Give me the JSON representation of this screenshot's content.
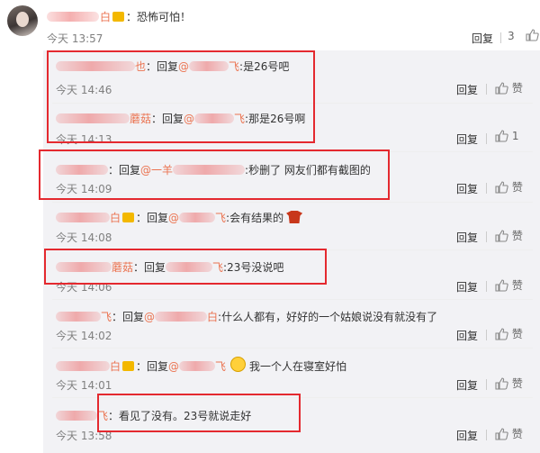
{
  "top_comment": {
    "text": "：恐怖可怕！",
    "time": "今天 13:57",
    "reply_label": "回复",
    "like_count": "3"
  },
  "replies": [
    {
      "name_tail": "也",
      "reply_prefix": "：回复",
      "mention_tail": "飞",
      "text": ":是26号吧",
      "time": "今天 14:46",
      "reply_label": "回复",
      "like_label": "赞"
    },
    {
      "name_tail": "蘑菇",
      "reply_prefix": "：回复",
      "mention_tail": "飞",
      "text": ":那是26号啊",
      "time": "今天 14:13",
      "reply_label": "回复",
      "like_count": "1"
    },
    {
      "reply_prefix": "：回复",
      "mention_head": "@一羊",
      "text": ":秒删了 网友们都有截图的",
      "time": "今天 14:09",
      "reply_label": "回复",
      "like_label": "赞"
    },
    {
      "name_tail": "白",
      "reply_prefix": "：回复",
      "mention_tail": "飞",
      "text": ":会有结果的",
      "time": "今天 14:08",
      "reply_label": "回复",
      "like_label": "赞"
    },
    {
      "name_tail": "蘑菇",
      "reply_prefix": "：回复",
      "mention_tail": "飞",
      "text": ":23号没说吧",
      "time": "今天 14:06",
      "reply_label": "回复",
      "like_label": "赞"
    },
    {
      "name_tail": "飞",
      "reply_prefix": "：回复",
      "mention_tail": "白",
      "text": ":什么人都有，好好的一个姑娘说没有就没有了",
      "time": "今天 14:02",
      "reply_label": "回复",
      "like_label": "赞"
    },
    {
      "name_tail": "白",
      "reply_prefix": "：回复",
      "mention_tail": "飞",
      "text": "我一个人在寝室好怕",
      "time": "今天 14:01",
      "reply_label": "回复",
      "like_label": "赞"
    },
    {
      "name_tail": "飞",
      "text": "：看见了没有。23号就说走好",
      "time": "今天 13:58",
      "reply_label": "回复",
      "like_label": "赞"
    }
  ],
  "colors": {
    "name": "#eb7350",
    "highlight_box": "#e4292f",
    "panel_bg": "#f2f2f5"
  }
}
